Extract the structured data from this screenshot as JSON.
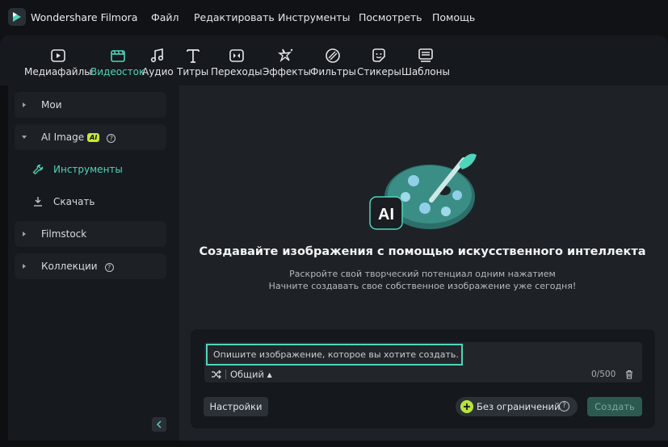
{
  "app": {
    "title": "Wondershare Filmora"
  },
  "menu": [
    "Файл",
    "Редактировать",
    "Инструменты",
    "Посмотреть",
    "Помощь"
  ],
  "toolbar": {
    "active": "Видеосток",
    "items": [
      {
        "label": "Медиафайлы",
        "icon": "media-icon"
      },
      {
        "label": "Видеосток",
        "icon": "stock-icon"
      },
      {
        "label": "Аудио",
        "icon": "music-icon"
      },
      {
        "label": "Титры",
        "icon": "title-icon"
      },
      {
        "label": "Переходы",
        "icon": "transition-icon"
      },
      {
        "label": "Эффекты",
        "icon": "effects-icon"
      },
      {
        "label": "Фильтры",
        "icon": "filter-icon"
      },
      {
        "label": "Стикеры",
        "icon": "sticker-icon"
      },
      {
        "label": "Шаблоны",
        "icon": "templates-icon"
      }
    ]
  },
  "sidebar": {
    "items": [
      {
        "label": "Мои"
      },
      {
        "label": "AI Image",
        "badge": "AI"
      },
      {
        "label": "Инструменты",
        "sub": true,
        "active": true
      },
      {
        "label": "Скачать",
        "sub": true
      },
      {
        "label": "Filmstock"
      },
      {
        "label": "Коллекции"
      }
    ]
  },
  "main": {
    "hero_title": "Создавайте изображения с помощью искусственного интеллекта",
    "hero_sub1": "Раскройте свой творческий потенциал одним нажатием",
    "hero_sub2": "Начните создавать свое собственное изображение уже сегодня!",
    "hero_badge": "AI",
    "prompt": {
      "placeholder": "Опишите изображение, которое вы хотите создать.",
      "value": "",
      "style": "Общий",
      "counter": "0/500"
    },
    "settings_label": "Настройки",
    "unlimited_label": "Без ограничений",
    "create_label": "Создать"
  },
  "colors": {
    "accent": "#4fd5bc",
    "badge": "#c6e83a",
    "background": "#1e2227"
  }
}
